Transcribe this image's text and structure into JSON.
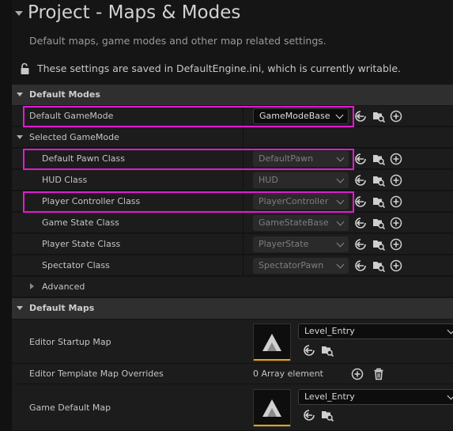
{
  "page": {
    "title": "Project - Maps & Modes",
    "description": "Default maps, game modes and other map related settings.",
    "notice": "These settings are saved in DefaultEngine.ini, which is currently writable."
  },
  "sections": {
    "default_modes": "Default Modes",
    "default_maps": "Default Maps"
  },
  "default_gamemode": {
    "label": "Default GameMode",
    "value": "GameModeBase"
  },
  "selected_gamemode": {
    "label": "Selected GameMode",
    "rows": [
      {
        "label": "Default Pawn Class",
        "value": "DefaultPawn"
      },
      {
        "label": "HUD Class",
        "value": "HUD"
      },
      {
        "label": "Player Controller Class",
        "value": "PlayerController"
      },
      {
        "label": "Game State Class",
        "value": "GameStateBase"
      },
      {
        "label": "Player State Class",
        "value": "PlayerState"
      },
      {
        "label": "Spectator Class",
        "value": "SpectatorPawn"
      }
    ],
    "advanced_label": "Advanced"
  },
  "maps": {
    "editor_startup": {
      "label": "Editor Startup Map",
      "value": "Level_Entry"
    },
    "template_overrides": {
      "label": "Editor Template Map Overrides",
      "value": "0 Array element"
    },
    "game_default": {
      "label": "Game Default Map",
      "value": "Level_Entry"
    }
  },
  "icons": {
    "use": "arrow-left-circle-icon",
    "browse": "folder-search-icon",
    "create": "plus-circle-icon",
    "delete": "trash-icon",
    "lock": "unlock-icon",
    "map_thumb": "level-thumbnail-icon"
  },
  "colors": {
    "highlight": "#e31ad2",
    "thumbnail_accent": "#e8a318"
  }
}
